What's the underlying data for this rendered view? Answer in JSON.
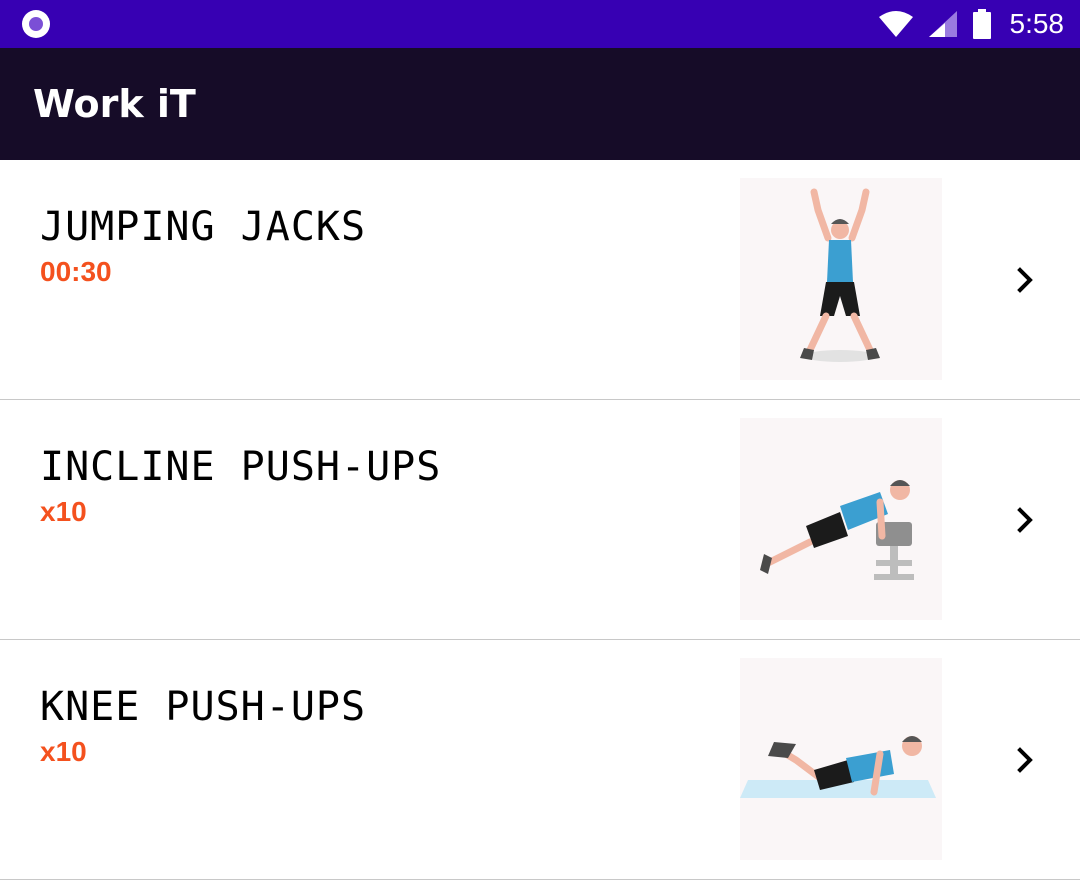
{
  "status_bar": {
    "time": "5:58",
    "icons": [
      "app-notification-icon",
      "wifi-icon",
      "cell-signal-icon",
      "battery-icon"
    ]
  },
  "app_bar": {
    "title": "Work iT"
  },
  "exercises": [
    {
      "name": "JUMPING JACKS",
      "value": "00:30",
      "image": "jumping-jacks-illustration"
    },
    {
      "name": "INCLINE PUSH-UPS",
      "value": "x10",
      "image": "incline-push-ups-illustration"
    },
    {
      "name": "KNEE PUSH-UPS",
      "value": "x10",
      "image": "knee-push-ups-illustration"
    }
  ],
  "colors": {
    "status_bar": "#3700b3",
    "app_bar": "#160c28",
    "accent_value": "#f4511e"
  }
}
